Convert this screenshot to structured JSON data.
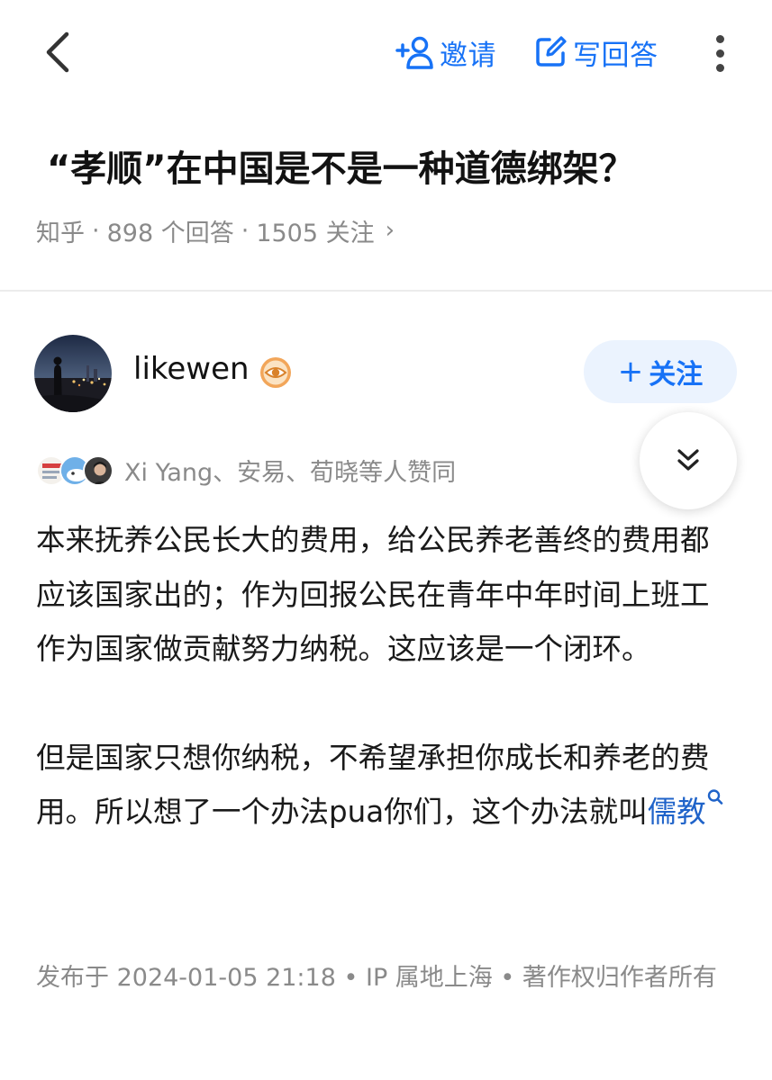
{
  "topbar": {
    "back_icon": "chevron-left-icon",
    "invite_label": "邀请",
    "invite_icon": "add-user-icon",
    "write_label": "写回答",
    "write_icon": "edit-icon",
    "more_icon": "more-vertical-icon"
  },
  "question": {
    "title": "“孝顺”在中国是不是一种道德绑架？",
    "source": "知乎",
    "answers_count": "898 个回答",
    "followers_count": "1505 关注",
    "sep": "·",
    "chevron": "›"
  },
  "author": {
    "name": "likewen",
    "badge_icon": "eye-badge-icon",
    "follow_label": "关注",
    "follow_plus": "+"
  },
  "voters": {
    "text": "Xi Yang、安易、荀晓等人赞同"
  },
  "answer": {
    "paragraph1": "本来抚养公民长大的费用，给公民养老善终的费用都应该国家出的；作为回报公民在青年中年时间上班工作为国家做贡献努力纳税。这应该是一个闭环。",
    "paragraph2_text": "但是国家只想你纳税，不希望承担你成长和养老的费用。所以想了一个办法pua你们，这个办法就叫",
    "paragraph2_link": "儒教"
  },
  "meta": {
    "publish_text": "发布于 2024-01-05 21:18 • IP 属地上海 • 著作权归作者所有"
  },
  "colors": {
    "accent": "#1772f6",
    "link": "#1f63c9",
    "muted": "#8a8a8a",
    "follow_bg": "#ebf3fe"
  }
}
